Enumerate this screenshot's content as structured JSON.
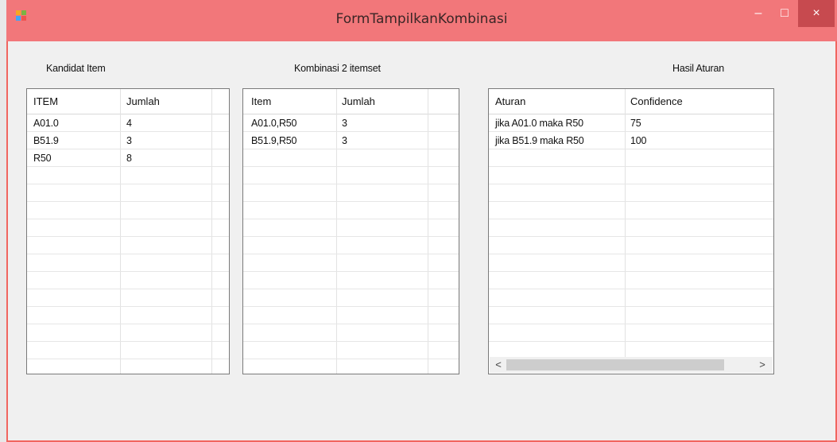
{
  "window": {
    "title": "FormTampilkanKombinasi",
    "minimize": "–",
    "maximize": "□",
    "close": "×"
  },
  "labels": {
    "kandidat": "Kandidat Item",
    "kombinasi": "Kombinasi 2 itemset",
    "hasil": "Hasil Aturan"
  },
  "kandidat": {
    "headers": [
      "ITEM",
      "Jumlah"
    ],
    "rows": [
      [
        "A01.0",
        "4"
      ],
      [
        "B51.9",
        "3"
      ],
      [
        "R50",
        "8"
      ]
    ]
  },
  "kombinasi": {
    "headers": [
      "Item",
      "Jumlah"
    ],
    "rows": [
      [
        "A01.0,R50",
        "3"
      ],
      [
        "B51.9,R50",
        "3"
      ]
    ]
  },
  "aturan": {
    "headers": [
      "Aturan",
      "Confidence"
    ],
    "rows": [
      [
        "jika A01.0 maka R50",
        "75"
      ],
      [
        "jika B51.9 maka R50",
        "100"
      ]
    ]
  },
  "scroll": {
    "left_arrow": "<",
    "right_arrow": ">"
  },
  "colors": {
    "titlebar": "#f2777a",
    "border": "#f1655f",
    "close": "#c74a4f"
  }
}
